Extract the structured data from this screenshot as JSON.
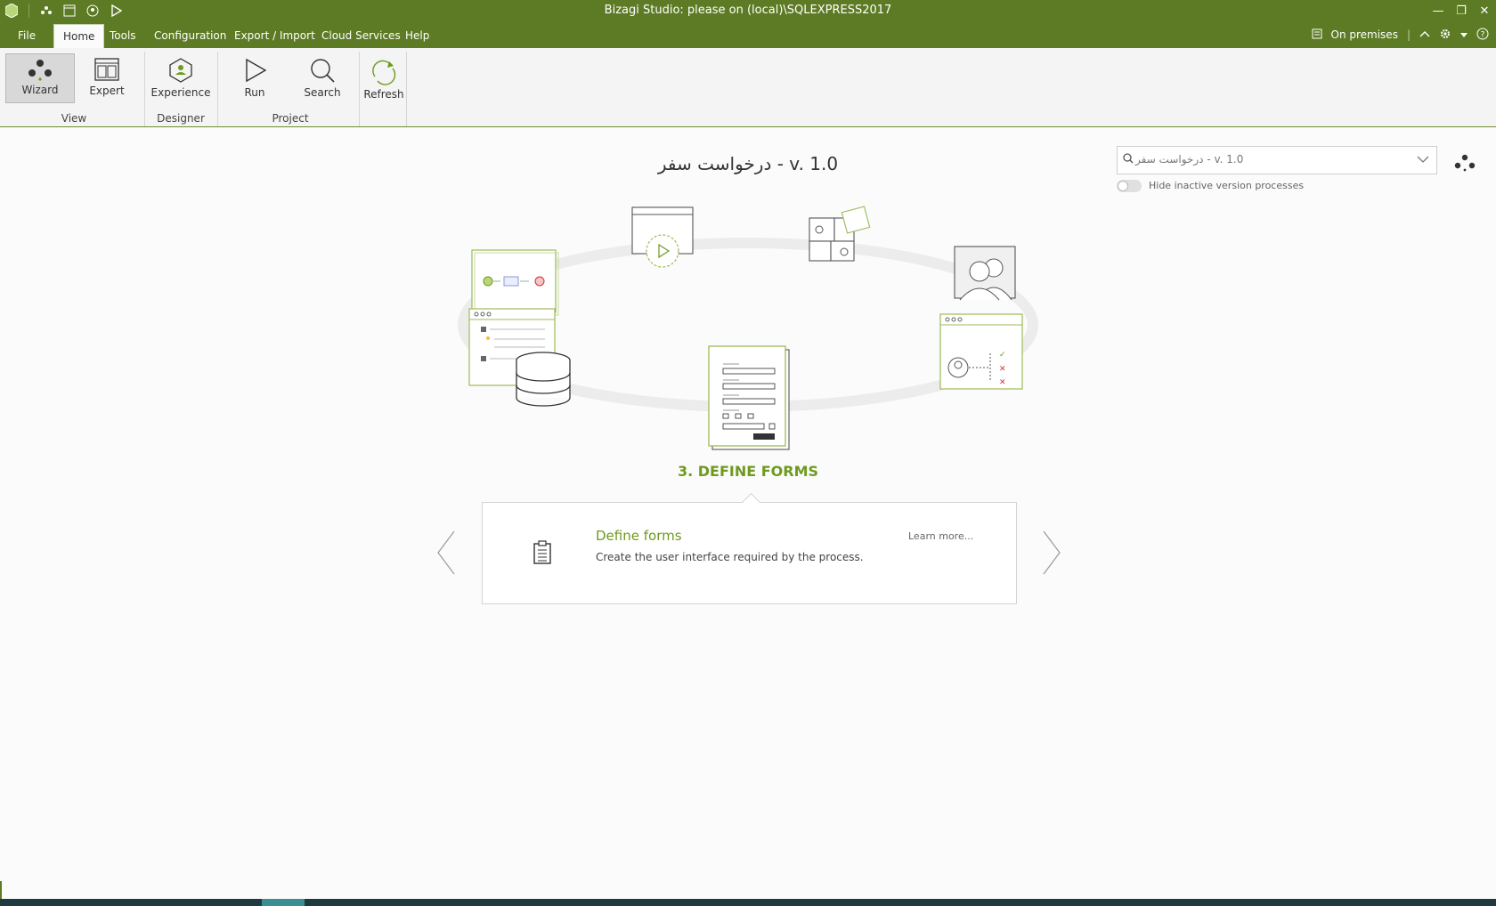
{
  "window": {
    "title": "Bizagi Studio: please  on (local)\\SQLEXPRESS2017",
    "controls": [
      "—",
      "❐",
      "✕"
    ]
  },
  "menu": {
    "tabs": [
      "File",
      "Home",
      "Tools",
      "Configuration",
      "Export / Import",
      "Cloud Services",
      "Help"
    ],
    "active_tab": "Home",
    "on_premises": "On premises",
    "divider": "|"
  },
  "ribbon": {
    "wizard": "Wizard",
    "expert": "Expert",
    "experience": "Experience",
    "run": "Run",
    "search": "Search",
    "refresh": "Refresh",
    "groups": {
      "view": "View",
      "designer": "Designer",
      "project": "Project"
    }
  },
  "main": {
    "title": "درخواست سفر - v. 1.0",
    "step_title": "3. DEFINE FORMS",
    "card": {
      "title": "Define forms",
      "description": "Create the user interface required by the process.",
      "learn_more": "Learn more..."
    }
  },
  "search": {
    "placeholder": "درخواست سفر - v. 1.0",
    "hide_inactive_label": "Hide inactive version processes",
    "hide_inactive_on": false
  },
  "colors": {
    "brand_green": "#5d7b24",
    "accent_green": "#6e9a1e",
    "ribbon_bg": "#f4f4f4",
    "page_bg": "#fbfbfb"
  },
  "icons": [
    "wizard-icon",
    "expert-icon",
    "experience-icon",
    "run-icon",
    "search-icon",
    "refresh-icon",
    "clipboard-icon",
    "database-icon",
    "puzzle-icon",
    "users-icon",
    "form-icon"
  ]
}
